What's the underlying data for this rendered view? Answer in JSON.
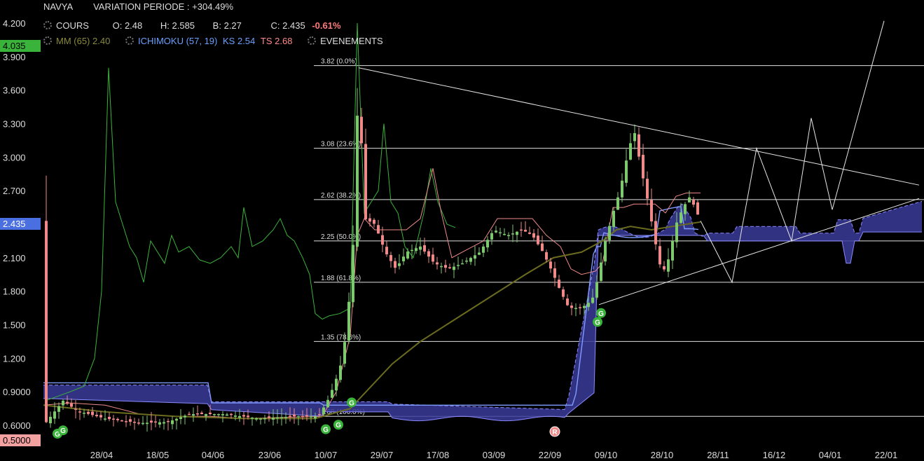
{
  "header": {
    "symbol": "NAVYA",
    "variation": "VARIATION PERIODE : +304.49%",
    "cours_label": "COURS",
    "o_label": "O:",
    "o_value": "2.48",
    "h_label": "H:",
    "h_value": "2.585",
    "b_label": "B:",
    "b_value": "2.27",
    "c_label": "C:",
    "c_value": "2.435",
    "change": "-0.61%",
    "mm_label": "MM (65)",
    "mm_value": "2.40",
    "ichimoku_label": "ICHIMOKU (57, 19)",
    "ks_label": "KS",
    "ks_value": "2.54",
    "ts_label": "TS",
    "ts_value": "2.68",
    "events_label": "EVENEMENTS"
  },
  "price_labels": {
    "high_marker": "4.035",
    "current_marker": "2.435",
    "low_marker": "0.5000"
  },
  "colors": {
    "background": "#000000",
    "up_candle": "#7ec86e",
    "down_candle": "#f08a8a",
    "green_line": "#3ab33a",
    "mm_line": "#6b6b1f",
    "kijun_line": "#f08a8a",
    "cloud_fill": "#3b3b9a",
    "cloud_edge": "#8a8aff",
    "high_marker_bg": "#3ab33a",
    "current_marker_bg": "#4a6fe0",
    "low_marker_bg": "#f2a0a0",
    "grid": "#ffffff"
  },
  "chart_data": {
    "type": "candlestick",
    "y_ticks": [
      "4.200",
      "3.900",
      "3.600",
      "3.300",
      "3.000",
      "2.700",
      "2.400",
      "2.100",
      "1.800",
      "1.500",
      "1.200",
      "0.9000",
      "0.6000"
    ],
    "y_tick_values": [
      4.2,
      3.9,
      3.6,
      3.3,
      3.0,
      2.7,
      2.4,
      2.1,
      1.8,
      1.5,
      1.2,
      0.9,
      0.6
    ],
    "ylim": [
      0.43,
      4.25
    ],
    "x_ticks": [
      "28/04",
      "18/05",
      "04/06",
      "23/06",
      "10/07",
      "29/07",
      "17/08",
      "03/09",
      "22/09",
      "09/10",
      "28/10",
      "28/11",
      "16/12",
      "04/01",
      "22/01"
    ],
    "fibonacci": [
      {
        "price": 3.82,
        "label": "3.82 (0.0%)"
      },
      {
        "price": 3.08,
        "label": "3.08 (23.6%)"
      },
      {
        "price": 2.62,
        "label": "2.62 (38.2%)"
      },
      {
        "price": 2.25,
        "label": "2.25 (50.0%)"
      },
      {
        "price": 1.88,
        "label": "1.88 (61.8%)"
      },
      {
        "price": 1.35,
        "label": "1.35 (78.6%)"
      },
      {
        "price": 0.68,
        "label": "0.68 (100.0%)"
      }
    ],
    "event_markers": [
      {
        "t": 0.03,
        "p": 0.6,
        "letter": "G",
        "type": "G"
      },
      {
        "t": 0.04,
        "p": 0.63,
        "letter": "G",
        "type": "G"
      },
      {
        "t": 0.63,
        "p": 0.64,
        "letter": "G",
        "type": "G"
      },
      {
        "t": 0.66,
        "p": 0.68,
        "letter": "G",
        "type": "G"
      },
      {
        "t": 0.68,
        "p": 0.88,
        "letter": "G",
        "type": "G"
      },
      {
        "t": 1.97,
        "p": 1.6,
        "letter": "G",
        "type": "G"
      },
      {
        "t": 2.0,
        "p": 1.68,
        "letter": "G",
        "type": "G"
      },
      {
        "t": 1.45,
        "p": 0.5,
        "letter": "R",
        "type": "R"
      }
    ],
    "x_range_months": [
      0,
      8.6
    ],
    "ohlc_note": "daily candles from April to early November"
  }
}
